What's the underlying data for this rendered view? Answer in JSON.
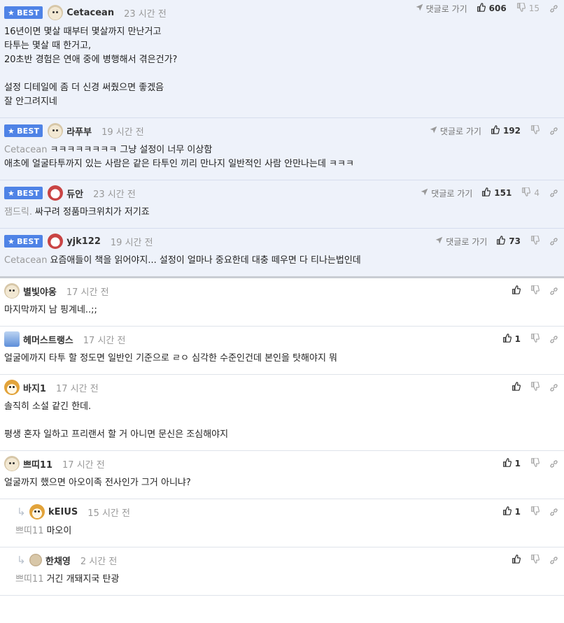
{
  "labels": {
    "best": "BEST",
    "reply": "댓글로 가기"
  },
  "comments": [
    {
      "best": true,
      "avatar": "cream",
      "nick": "Cetacean",
      "time": "23 시간 전",
      "up": "606",
      "down": "15",
      "mention": "",
      "lines": [
        "16년이면 몇살 때부터 몇살까지 만난거고",
        "타투는 몇살 때 한거고,",
        "20초반 경험은 연애 중에 병행해서 겪은건가?",
        "",
        "설정 디테일에 좀 더 신경 써줬으면 좋겠음",
        "잘 안그려지네"
      ]
    },
    {
      "best": true,
      "avatar": "cream",
      "nick": "라푸부",
      "time": "19 시간 전",
      "up": "192",
      "down": "",
      "mention": "Cetacean",
      "lines": [
        "ㅋㅋㅋㅋㅋㅋㅋㅋ 그냥 설정이 너무 이상함",
        "애초에 얼굴타투까지 있는 사람은 같은 타투인 끼리 만나지 일반적인 사람 안만나는데 ㅋㅋㅋ"
      ]
    },
    {
      "best": true,
      "avatar": "red",
      "nick": "듀안",
      "time": "23 시간 전",
      "up": "151",
      "down": "4",
      "mention": "잼드릭.",
      "lines": [
        "싸구려 정품마크위치가 저기죠"
      ]
    },
    {
      "best": true,
      "avatar": "red",
      "nick": "yjk122",
      "time": "19 시간 전",
      "up": "73",
      "down": "",
      "mention": "Cetacean",
      "lines": [
        "요즘애들이 책을 읽어야지... 설정이 얼마나 중요한데 대충 떼우면 다 티나는법인데"
      ]
    },
    {
      "best": false,
      "avatar": "cream",
      "nick": "별빛야옹",
      "time": "17 시간 전",
      "up": "",
      "down": "",
      "mention": "",
      "lines": [
        "마지막까지 남 핑계네..;;"
      ]
    },
    {
      "best": false,
      "avatar": "blue",
      "nick": "헤머스트랭스",
      "time": "17 시간 전",
      "up": "1",
      "down": "",
      "mention": "",
      "lines": [
        "얼굴에까지 타투 할 정도면 일반인 기준으로 ㄹㅇ 심각한 수준인건데 본인을 탓해야지 뭐"
      ]
    },
    {
      "best": false,
      "avatar": "fox",
      "nick": "바지1",
      "time": "17 시간 전",
      "up": "",
      "down": "",
      "mention": "",
      "lines": [
        "솔직히 소설 같긴 한데.",
        "",
        "평생 혼자 일하고 프리랜서 할 거 아니면 문신은 조심해야지"
      ]
    },
    {
      "best": false,
      "avatar": "cream",
      "nick": "쁘띠11",
      "time": "17 시간 전",
      "up": "1",
      "down": "",
      "mention": "",
      "lines": [
        "얼굴까지 했으면 아오이족 전사인가 그거 아니냐?"
      ]
    },
    {
      "best": false,
      "reply": true,
      "avatar": "fox",
      "nick": "kEIUS",
      "time": "15 시간 전",
      "up": "1",
      "down": "",
      "mention": "쁘띠11",
      "lines": [
        "마오이"
      ]
    },
    {
      "best": false,
      "reply": true,
      "avatar": "tan",
      "nick": "한채영",
      "time": "2 시간 전",
      "up": "",
      "down": "",
      "mention": "쁘띠11",
      "lines": [
        "거긴 개돼지국 탄광"
      ]
    }
  ]
}
